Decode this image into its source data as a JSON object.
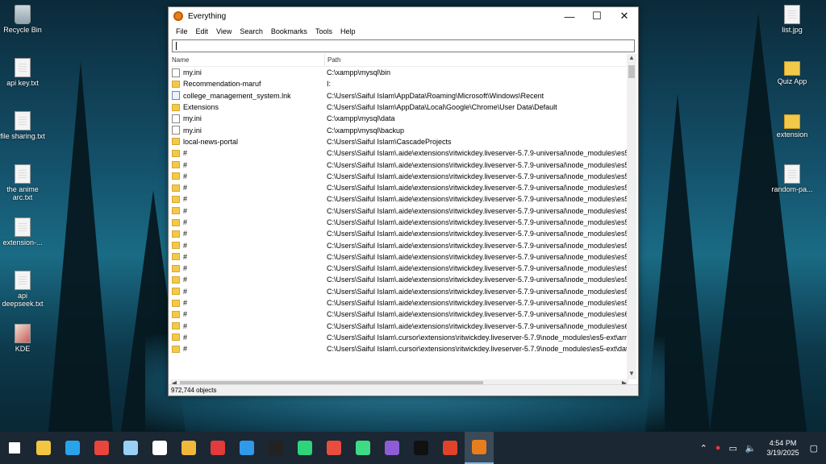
{
  "desktop": {
    "left_icons": [
      "Recycle Bin",
      "api key.txt",
      "file sharing.txt",
      "the anime arc.txt",
      "extension-...",
      "api deepseek.txt",
      "KDE"
    ],
    "right_icons": [
      "list.jpg",
      "Quiz App",
      "extension",
      "random-pa..."
    ]
  },
  "window": {
    "title": "Everything",
    "icon": "magnifier-icon",
    "controls": {
      "minimize": "—",
      "maximize": "☐",
      "close": "✕"
    },
    "menu": [
      "File",
      "Edit",
      "View",
      "Search",
      "Bookmarks",
      "Tools",
      "Help"
    ],
    "search": {
      "value": "",
      "placeholder": ""
    },
    "columns": {
      "name": "Name",
      "path": "Path"
    },
    "rows": [
      {
        "icon": "file",
        "name": "my.ini",
        "path": "C:\\xampp\\mysql\\bin"
      },
      {
        "icon": "folder",
        "name": "Recommendation-maruf",
        "path": "I:"
      },
      {
        "icon": "link",
        "name": "college_management_system.lnk",
        "path": "C:\\Users\\Saiful Islam\\AppData\\Roaming\\Microsoft\\Windows\\Recent"
      },
      {
        "icon": "folder",
        "name": "Extensions",
        "path": "C:\\Users\\Saiful Islam\\AppData\\Local\\Google\\Chrome\\User Data\\Default"
      },
      {
        "icon": "file",
        "name": "my.ini",
        "path": "C:\\xampp\\mysql\\data"
      },
      {
        "icon": "file",
        "name": "my.ini",
        "path": "C:\\xampp\\mysql\\backup"
      },
      {
        "icon": "folder",
        "name": "local-news-portal",
        "path": "C:\\Users\\Saiful Islam\\CascadeProjects"
      },
      {
        "icon": "folder",
        "name": "#",
        "path": "C:\\Users\\Saiful Islam\\.aide\\extensions\\ritwickdey.liveserver-5.7.9-universal\\node_modules\\es5-"
      },
      {
        "icon": "folder",
        "name": "#",
        "path": "C:\\Users\\Saiful Islam\\.aide\\extensions\\ritwickdey.liveserver-5.7.9-universal\\node_modules\\es5-"
      },
      {
        "icon": "folder",
        "name": "#",
        "path": "C:\\Users\\Saiful Islam\\.aide\\extensions\\ritwickdey.liveserver-5.7.9-universal\\node_modules\\es5-"
      },
      {
        "icon": "folder",
        "name": "#",
        "path": "C:\\Users\\Saiful Islam\\.aide\\extensions\\ritwickdey.liveserver-5.7.9-universal\\node_modules\\es5-"
      },
      {
        "icon": "folder",
        "name": "#",
        "path": "C:\\Users\\Saiful Islam\\.aide\\extensions\\ritwickdey.liveserver-5.7.9-universal\\node_modules\\es5-"
      },
      {
        "icon": "folder",
        "name": "#",
        "path": "C:\\Users\\Saiful Islam\\.aide\\extensions\\ritwickdey.liveserver-5.7.9-universal\\node_modules\\es5-"
      },
      {
        "icon": "folder",
        "name": "#",
        "path": "C:\\Users\\Saiful Islam\\.aide\\extensions\\ritwickdey.liveserver-5.7.9-universal\\node_modules\\es5-"
      },
      {
        "icon": "folder",
        "name": "#",
        "path": "C:\\Users\\Saiful Islam\\.aide\\extensions\\ritwickdey.liveserver-5.7.9-universal\\node_modules\\es5-"
      },
      {
        "icon": "folder",
        "name": "#",
        "path": "C:\\Users\\Saiful Islam\\.aide\\extensions\\ritwickdey.liveserver-5.7.9-universal\\node_modules\\es5-"
      },
      {
        "icon": "folder",
        "name": "#",
        "path": "C:\\Users\\Saiful Islam\\.aide\\extensions\\ritwickdey.liveserver-5.7.9-universal\\node_modules\\es5-"
      },
      {
        "icon": "folder",
        "name": "#",
        "path": "C:\\Users\\Saiful Islam\\.aide\\extensions\\ritwickdey.liveserver-5.7.9-universal\\node_modules\\es5-"
      },
      {
        "icon": "folder",
        "name": "#",
        "path": "C:\\Users\\Saiful Islam\\.aide\\extensions\\ritwickdey.liveserver-5.7.9-universal\\node_modules\\es5-"
      },
      {
        "icon": "folder",
        "name": "#",
        "path": "C:\\Users\\Saiful Islam\\.aide\\extensions\\ritwickdey.liveserver-5.7.9-universal\\node_modules\\es5-"
      },
      {
        "icon": "folder",
        "name": "#",
        "path": "C:\\Users\\Saiful Islam\\.aide\\extensions\\ritwickdey.liveserver-5.7.9-universal\\node_modules\\es5-"
      },
      {
        "icon": "folder",
        "name": "#",
        "path": "C:\\Users\\Saiful Islam\\.aide\\extensions\\ritwickdey.liveserver-5.7.9-universal\\node_modules\\es6-"
      },
      {
        "icon": "folder",
        "name": "#",
        "path": "C:\\Users\\Saiful Islam\\.aide\\extensions\\ritwickdey.liveserver-5.7.9-universal\\node_modules\\es6-"
      },
      {
        "icon": "folder",
        "name": "#",
        "path": "C:\\Users\\Saiful Islam\\.cursor\\extensions\\ritwickdey.liveserver-5.7.9\\node_modules\\es5-ext\\arra"
      },
      {
        "icon": "folder",
        "name": "#",
        "path": "C:\\Users\\Saiful Islam\\.cursor\\extensions\\ritwickdey.liveserver-5.7.9\\node_modules\\es5-ext\\dat"
      }
    ],
    "status": "972,744 objects"
  },
  "taskbar": {
    "apps": [
      {
        "name": "start-button",
        "color": "#ffffff"
      },
      {
        "name": "file-explorer",
        "color": "#f2c641"
      },
      {
        "name": "edge",
        "color": "#2aa4e8"
      },
      {
        "name": "chrome",
        "color": "#e8453c"
      },
      {
        "name": "notepad",
        "color": "#9ad0f5"
      },
      {
        "name": "brave-bold",
        "color": "#ffffff"
      },
      {
        "name": "store",
        "color": "#f0b83a"
      },
      {
        "name": "recorder",
        "color": "#e33b3b"
      },
      {
        "name": "vscode",
        "color": "#2f9ae8"
      },
      {
        "name": "capcut",
        "color": "#222222"
      },
      {
        "name": "green-app",
        "color": "#2ed47a"
      },
      {
        "name": "red-app",
        "color": "#e84d3d"
      },
      {
        "name": "android-studio",
        "color": "#3ddc84"
      },
      {
        "name": "github",
        "color": "#8e5cd6"
      },
      {
        "name": "capcut-alt",
        "color": "#111111"
      },
      {
        "name": "wps-office",
        "color": "#e0432a"
      },
      {
        "name": "everything",
        "color": "#e87d1e"
      }
    ],
    "time": "4:54 PM",
    "date": "3/19/2025"
  }
}
